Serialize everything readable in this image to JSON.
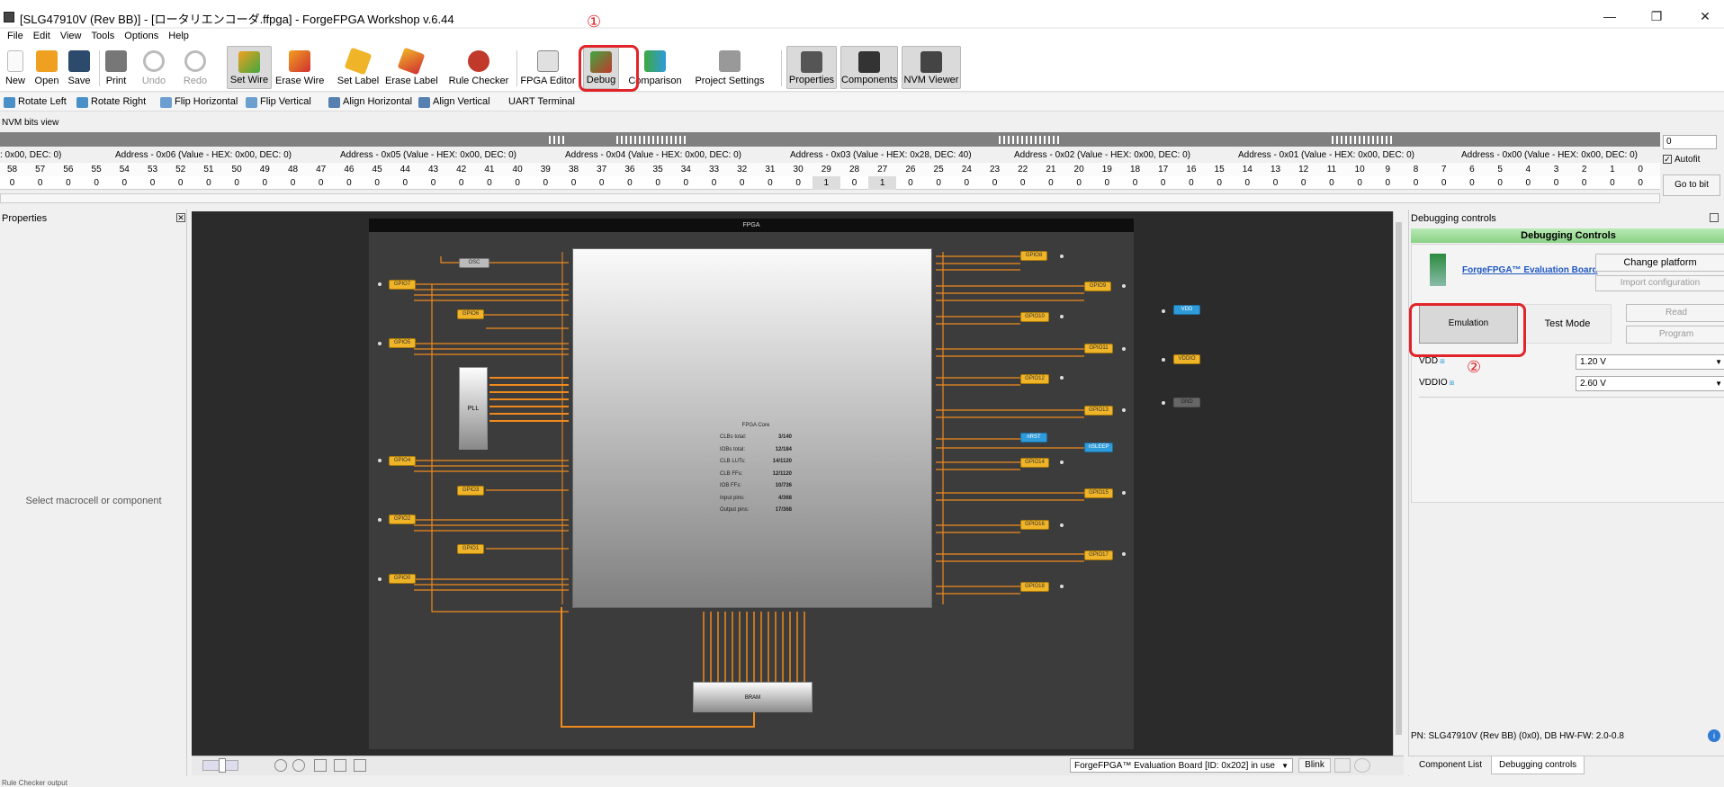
{
  "window": {
    "title": "[SLG47910V (Rev BB)] - [ロータリエンコーダ.ffpga] - ForgeFPGA Workshop v.6.44"
  },
  "menu": [
    "File",
    "Edit",
    "View",
    "Tools",
    "Options",
    "Help"
  ],
  "toolbar": {
    "new": "New",
    "open": "Open",
    "save": "Save",
    "print": "Print",
    "undo": "Undo",
    "redo": "Redo",
    "set_wire": "Set Wire",
    "erase_wire": "Erase Wire",
    "set_label": "Set Label",
    "erase_label": "Erase Label",
    "rule_checker": "Rule Checker",
    "fpga_editor": "FPGA Editor",
    "debug": "Debug",
    "comparison": "Comparison",
    "project_settings": "Project Settings",
    "properties": "Properties",
    "components": "Components",
    "nvm_viewer": "NVM Viewer"
  },
  "toolbar2": {
    "rotate_left": "Rotate Left",
    "rotate_right": "Rotate Right",
    "flip_horizontal": "Flip Horizontal",
    "flip_vertical": "Flip Vertical",
    "align_horizontal": "Align Horizontal",
    "align_vertical": "Align Vertical",
    "uart_terminal": "UART Terminal"
  },
  "nvm": {
    "title": "NVM bits view",
    "addresses": [
      ": 0x00, DEC: 0)",
      "Address - 0x06 (Value - HEX: 0x00, DEC: 0)",
      "Address - 0x05 (Value - HEX: 0x00, DEC: 0)",
      "Address - 0x04 (Value - HEX: 0x00, DEC: 0)",
      "Address - 0x03 (Value - HEX: 0x28, DEC: 40)",
      "Address - 0x02 (Value - HEX: 0x00, DEC: 0)",
      "Address - 0x01 (Value - HEX: 0x00, DEC: 0)",
      "Address - 0x00 (Value - HEX: 0x00, DEC: 0)"
    ],
    "bit_numbers": [
      "58",
      "57",
      "56",
      "55",
      "54",
      "53",
      "52",
      "51",
      "50",
      "49",
      "48",
      "47",
      "46",
      "45",
      "44",
      "43",
      "42",
      "41",
      "40",
      "39",
      "38",
      "37",
      "36",
      "35",
      "34",
      "33",
      "32",
      "31",
      "30",
      "29",
      "28",
      "27",
      "26",
      "25",
      "24",
      "23",
      "22",
      "21",
      "20",
      "19",
      "18",
      "17",
      "16",
      "15",
      "14",
      "13",
      "12",
      "11",
      "10",
      "9",
      "8",
      "7",
      "6",
      "5",
      "4",
      "3",
      "2",
      "1",
      "0"
    ],
    "bit_values": [
      "0",
      "0",
      "0",
      "0",
      "0",
      "0",
      "0",
      "0",
      "0",
      "0",
      "0",
      "0",
      "0",
      "0",
      "0",
      "0",
      "0",
      "0",
      "0",
      "0",
      "0",
      "0",
      "0",
      "0",
      "0",
      "0",
      "0",
      "0",
      "0",
      "1",
      "0",
      "1",
      "0",
      "0",
      "0",
      "0",
      "0",
      "0",
      "0",
      "0",
      "0",
      "0",
      "0",
      "0",
      "0",
      "0",
      "0",
      "0",
      "0",
      "0",
      "0",
      "0",
      "0",
      "0",
      "0",
      "0",
      "0",
      "0",
      "0"
    ],
    "addr_input": "0",
    "autofit_label": "Autofit",
    "autofit_checked": true,
    "goto_label": "Go to bit"
  },
  "properties": {
    "title": "Properties",
    "hint": "Select macrocell or component"
  },
  "fpga": {
    "board_label": "FPGA",
    "core": {
      "title": "FPGA Core",
      "stats": [
        {
          "k": "CLBs total:",
          "v": "3/140"
        },
        {
          "k": "IOBs total:",
          "v": "12/184"
        },
        {
          "k": "CLB LUTs:",
          "v": "14/1120"
        },
        {
          "k": "CLB FFs:",
          "v": "12/1120"
        },
        {
          "k": "IOB FFs:",
          "v": "10/736"
        },
        {
          "k": "Input pins:",
          "v": "4/368"
        },
        {
          "k": "Output pins:",
          "v": "17/368"
        }
      ]
    },
    "osc": "OSC",
    "pll": "PLL",
    "bram": "BRAM",
    "gpio_left": [
      "GPIO7",
      "GPIO6",
      "GPIO5",
      "GPIO4",
      "GPIO3",
      "GPIO2",
      "GPIO1",
      "GPIO0"
    ],
    "gpio_right": [
      "GPIO8",
      "GPIO9",
      "GPIO10",
      "GPIO11",
      "GPIO12",
      "GPIO13",
      "nRST",
      "nSLEEP",
      "GPIO14",
      "GPIO15",
      "GPIO16",
      "GPIO17",
      "GPIO18"
    ],
    "power": [
      "VDD",
      "VDDIO",
      "GND"
    ]
  },
  "canvas_bar": {
    "board_select": "ForgeFPGA™ Evaluation Board [ID: 0x202] in use",
    "blink": "Blink"
  },
  "debug": {
    "panel_title": "Debugging controls",
    "header": "Debugging Controls",
    "board_link": "ForgeFPGA™ Evaluation Board",
    "change_platform": "Change platform",
    "import_configuration": "Import configuration",
    "emulation": "Emulation",
    "test_mode": "Test Mode",
    "read": "Read",
    "program": "Program",
    "vdd_label": "VDD",
    "vdd_value": "1.20 V",
    "vddio_label": "VDDIO",
    "vddio_value": "2.60 V",
    "footer": "PN: SLG47910V (Rev BB) (0x0), DB HW-FW: 2.0-0.8"
  },
  "bottom_tabs": [
    "Component List",
    "Debugging controls"
  ],
  "status": "Rule Checker output",
  "annotations": {
    "step1": "①",
    "step2": "②"
  },
  "colors": {
    "accent_red": "#e0242a",
    "wire": "#f08a1c",
    "gpio": "#f0b428",
    "debug_green": "#8ad186"
  }
}
